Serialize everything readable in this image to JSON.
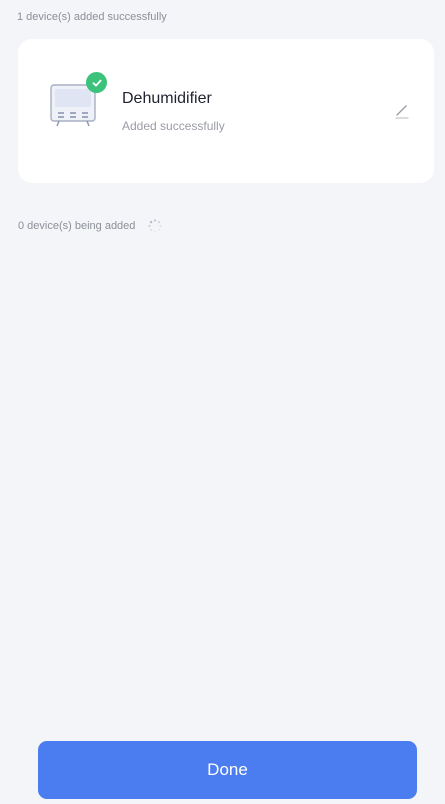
{
  "added_section": {
    "header": "1 device(s) added successfully"
  },
  "device": {
    "name": "Dehumidifier",
    "status": "Added successfully",
    "icon": "dehumidifier-icon",
    "badge_icon": "check-icon",
    "action_icon": "edit-pencil-icon"
  },
  "pending_section": {
    "header": "0 device(s) being added",
    "icon": "loading-spinner-icon"
  },
  "footer": {
    "done_label": "Done"
  },
  "colors": {
    "background": "#f4f5f9",
    "card": "#ffffff",
    "success_green": "#3cc27a",
    "primary_button": "#4b7cf0",
    "text_primary": "#1f2230",
    "text_secondary": "#9a9ca5"
  }
}
